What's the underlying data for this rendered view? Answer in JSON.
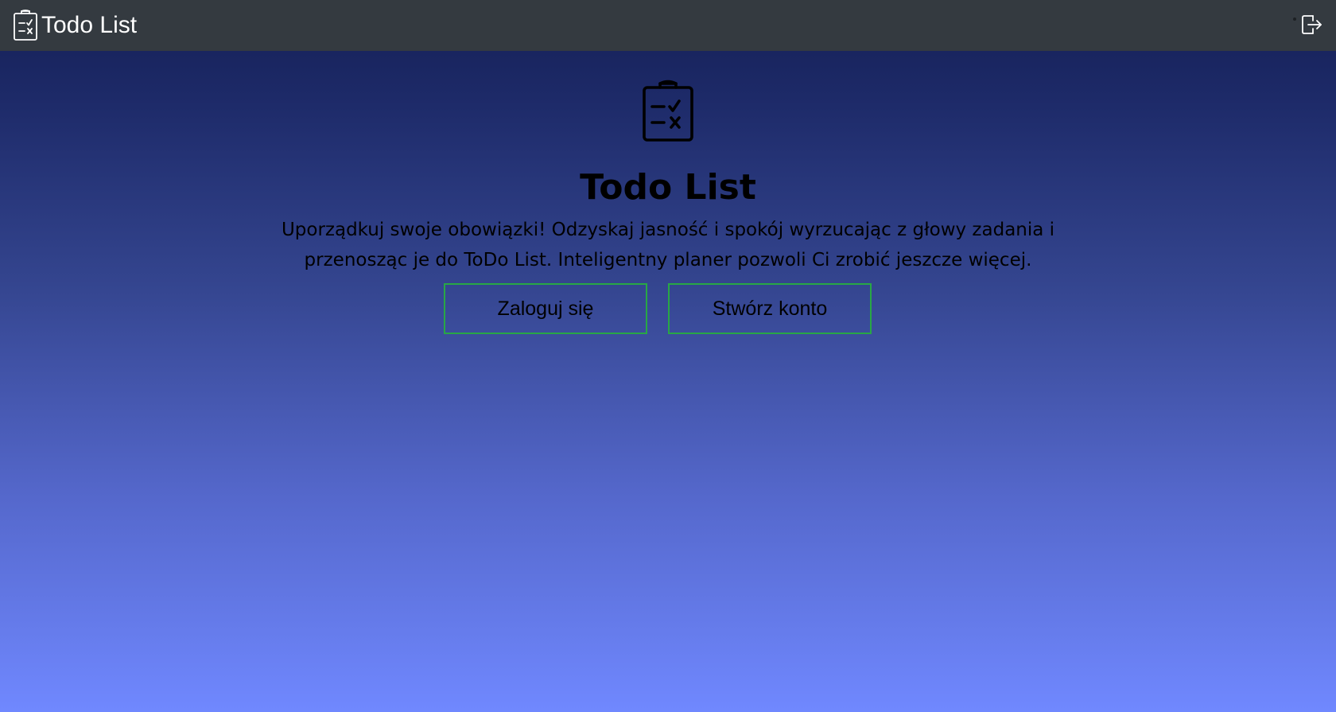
{
  "navbar": {
    "brand_text": "Todo List",
    "brand_icon": "clipboard-check-icon",
    "logout_icon": "logout-icon",
    "background": "#343a40"
  },
  "hero": {
    "icon": "clipboard-check-icon",
    "title": "Todo List",
    "description": "Uporządkuj swoje obowiązki! Odzyskaj jasność i spokój wyrzucając z głowy zadania i przenosząc je do ToDo List. Inteligentny planer pozwoli Ci zrobić jeszcze więcej.",
    "login_label": "Zaloguj się",
    "register_label": "Stwórz konto"
  },
  "colors": {
    "button_border": "#28a745",
    "gradient_top": "#141f55",
    "gradient_bottom": "#7088ff"
  }
}
